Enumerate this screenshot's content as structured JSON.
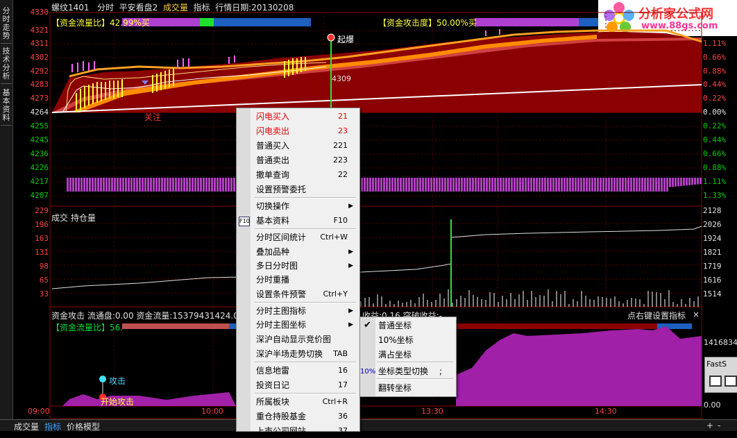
{
  "header": {
    "symbol": "螺纹1401",
    "mode": "分时",
    "indicator_name": "平安看盘2",
    "volume_label": "成交量",
    "indicator_label": "指标",
    "date_label": "行情日期:20130208"
  },
  "left_tabs": [
    "分时走势",
    "技术分析",
    "基本资料"
  ],
  "price_axis_left": [
    "4330",
    "4321",
    "4311",
    "4302",
    "4292",
    "4283",
    "4273",
    "4264",
    "4255",
    "4245",
    "4236",
    "4226",
    "4217",
    "4207"
  ],
  "pct_axis_right": [
    "1.11%",
    "0.88%",
    "0.66%",
    "0.44%",
    "0.22%",
    "0.00%",
    "0.22%",
    "0.44%",
    "0.66%",
    "0.88%",
    "1.11%",
    "1.33%"
  ],
  "top_panel": {
    "flow_ratio_label": "【资金流量比】42.99%买",
    "attack_label": "【资金攻击度】50.00%买",
    "up_marker": "起爆",
    "cursor_value": "4309",
    "attention_label": "关注"
  },
  "vol_panel": {
    "title": "成交 持仓量",
    "axis_left": [
      "229",
      "196",
      "163",
      "131",
      "98",
      "65",
      "33"
    ],
    "axis_right": [
      "2128",
      "2026",
      "1924",
      "1821",
      "1719",
      "1616",
      "1514"
    ]
  },
  "bottom_panel": {
    "info_line": "资金攻击  流通盘:0.00  资金流量:15379431424.00",
    "info_tail": "收益:0.16  突破收益:-",
    "right_hint": "点右键设置指标",
    "flow_ratio_label": "【资金流量比】56.",
    "right_value": "1416834",
    "right_zero": "0.00",
    "marker_attack": "攻击",
    "marker_start": "开始攻击"
  },
  "time_axis": [
    "09:00",
    "10:00",
    "13:30",
    "14:30"
  ],
  "context_menu": {
    "items": [
      {
        "label": "闪电买入",
        "key": "21",
        "red": true
      },
      {
        "label": "闪电卖出",
        "key": "23",
        "red": true
      },
      {
        "label": "普通买入",
        "key": "221"
      },
      {
        "label": "普通卖出",
        "key": "223"
      },
      {
        "label": "撤单查询",
        "key": "22"
      },
      {
        "label": "设置预警委托",
        "key": ""
      },
      {
        "label": "切换操作",
        "key": "",
        "arrow": true
      },
      {
        "label": "基本资料",
        "key": "F10"
      },
      {
        "label": "分时区间统计",
        "key": "Ctrl+W"
      },
      {
        "label": "叠加品种",
        "key": "",
        "arrow": true
      },
      {
        "label": "多日分时图",
        "key": "",
        "arrow": true
      },
      {
        "label": "分时重播",
        "key": ""
      },
      {
        "label": "设置条件预警",
        "key": "Ctrl+Y"
      },
      {
        "label": "分时主图指标",
        "key": "",
        "arrow": true
      },
      {
        "label": "分时主图坐标",
        "key": "",
        "arrow": true
      },
      {
        "label": "深沪自动显示竞价图",
        "key": ""
      },
      {
        "label": "深沪半场走势切换",
        "key": "TAB"
      },
      {
        "label": "信息地雷",
        "key": "16"
      },
      {
        "label": "投资日记",
        "key": "17"
      },
      {
        "label": "所属板块",
        "key": "Ctrl+R"
      },
      {
        "label": "重仓持股基金",
        "key": "36"
      },
      {
        "label": "上市公司网站",
        "key": "37"
      }
    ],
    "f10_icon": "F10"
  },
  "sub_menu": {
    "items": [
      {
        "label": "普通坐标",
        "checked": true
      },
      {
        "label": "10%坐标"
      },
      {
        "label": "满占坐标"
      },
      {
        "label": "坐标类型切换",
        "key": ";"
      },
      {
        "label": "翻转坐标"
      }
    ],
    "pct_icon": "10%"
  },
  "bottom_tabs": [
    "成交量",
    "指标",
    "价格模型"
  ],
  "corner_buttons": [
    "+",
    "-"
  ],
  "right_window": {
    "label": "FastS"
  },
  "logo": {
    "title": "分析家公式网",
    "url": "www.88gs.com"
  }
}
